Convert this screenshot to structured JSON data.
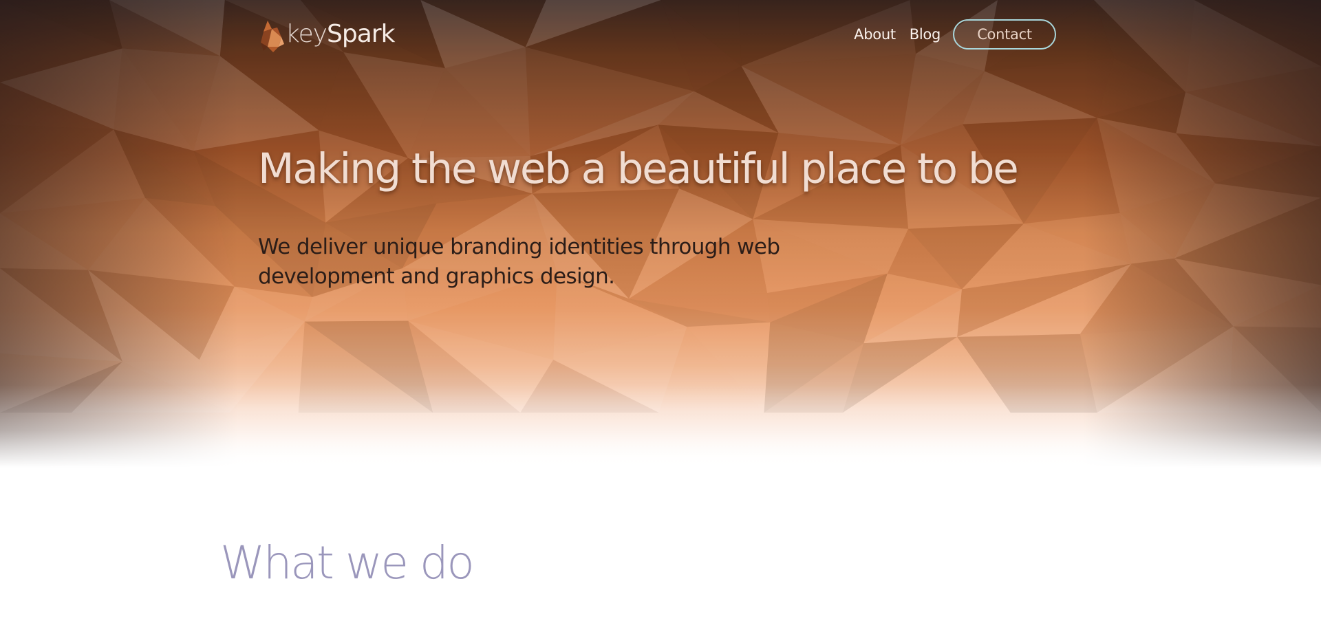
{
  "header": {
    "logo": {
      "text_light": "key",
      "text_bold": "Spark",
      "icon": "flame-logo-icon"
    },
    "nav": {
      "about_label": "About",
      "blog_label": "Blog",
      "contact_label": "Contact"
    }
  },
  "hero": {
    "title": "Making the web a beautiful place to be",
    "subtitle": "We deliver unique branding identities through web development and graphics design."
  },
  "section": {
    "title": "What we do"
  },
  "colors": {
    "hero_dark": "#2b2220",
    "hero_mid": "#a85a2c",
    "hero_light": "#e8945c",
    "contact_border": "#a9d7dc",
    "section_title": "#9a96bb"
  }
}
